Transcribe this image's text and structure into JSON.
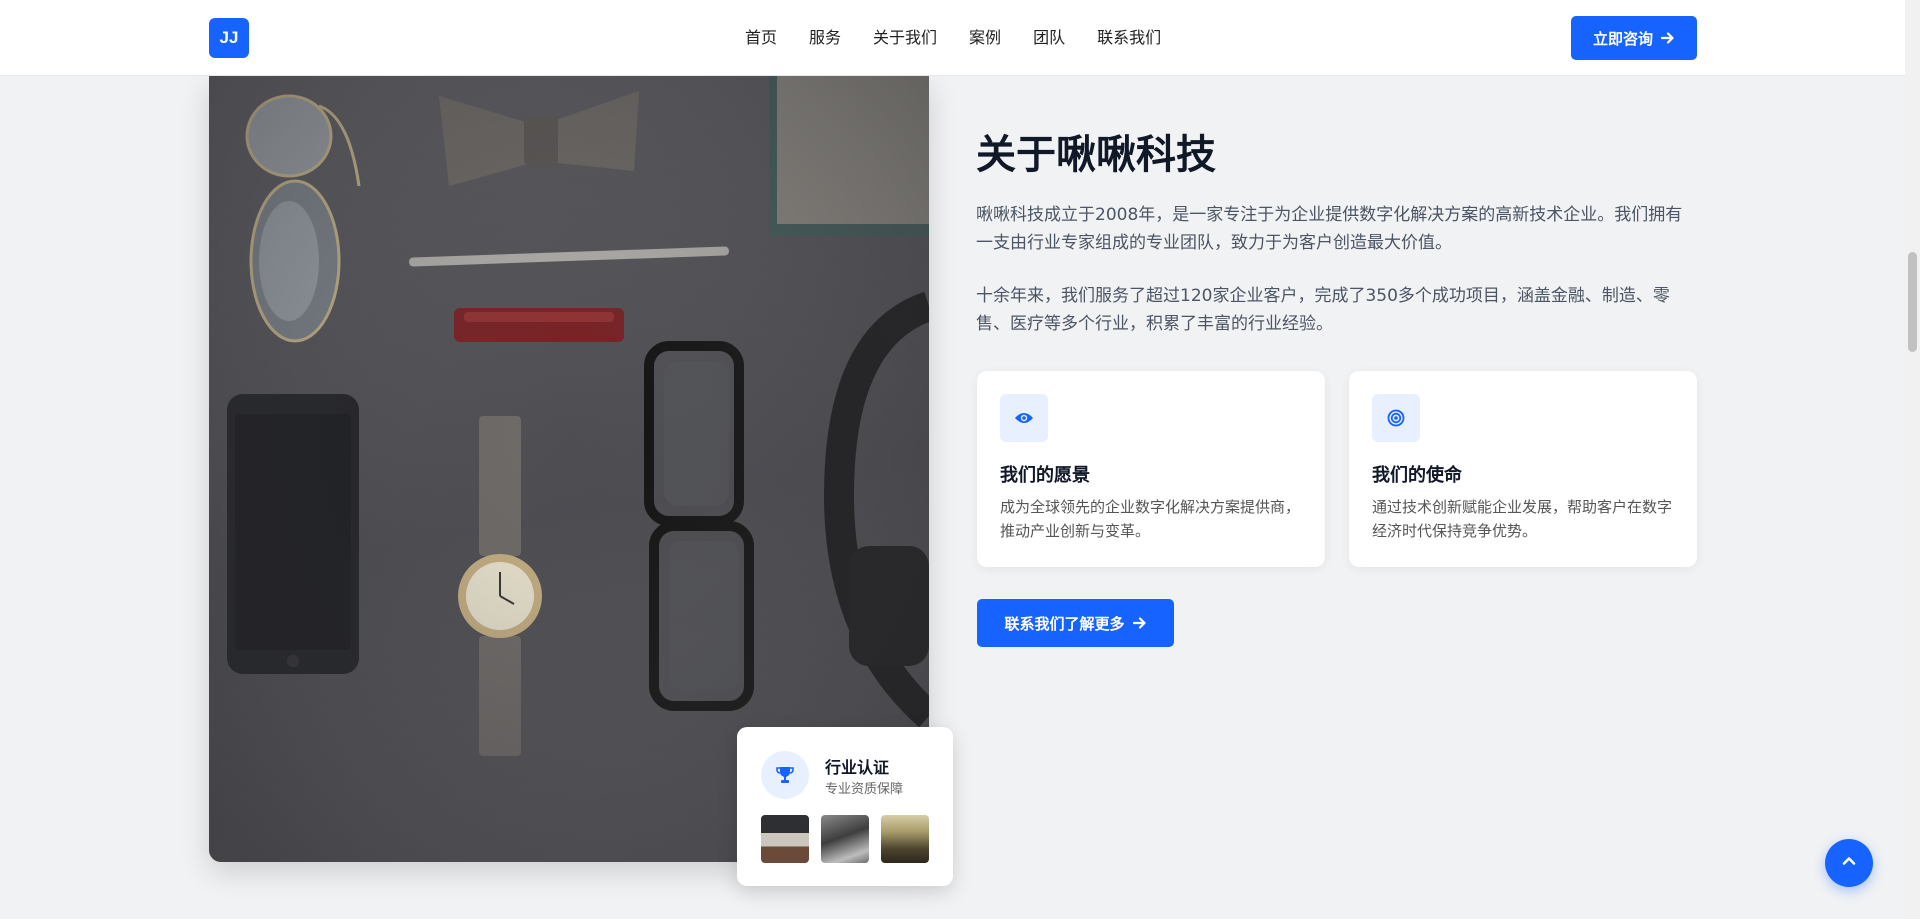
{
  "header": {
    "logo_text": "JJ",
    "nav": [
      "首页",
      "服务",
      "关于我们",
      "案例",
      "团队",
      "联系我们"
    ],
    "cta_label": "立即咨询"
  },
  "about": {
    "title": "关于啾啾科技",
    "paragraph_1": "啾啾科技成立于2008年，是一家专注于为企业提供数字化解决方案的高新技术企业。我们拥有一支由行业专家组成的专业团队，致力于为客户创造最大价值。",
    "paragraph_2": "十余年来，我们服务了超过120家企业客户，完成了350多个成功项目，涵盖金融、制造、零售、医疗等多个行业，积累了丰富的行业经验。",
    "cards": [
      {
        "icon": "eye-icon",
        "title": "我们的愿景",
        "desc": "成为全球领先的企业数字化解决方案提供商，推动产业创新与变革。"
      },
      {
        "icon": "target-icon",
        "title": "我们的使命",
        "desc": "通过技术创新赋能企业发展，帮助客户在数字经济时代保持竞争优势。"
      }
    ],
    "cta_label": "联系我们了解更多"
  },
  "certification": {
    "icon": "trophy-icon",
    "title": "行业认证",
    "subtitle": "专业资质保障"
  },
  "colors": {
    "primary": "#1663ff",
    "background": "#f1f2f4"
  }
}
